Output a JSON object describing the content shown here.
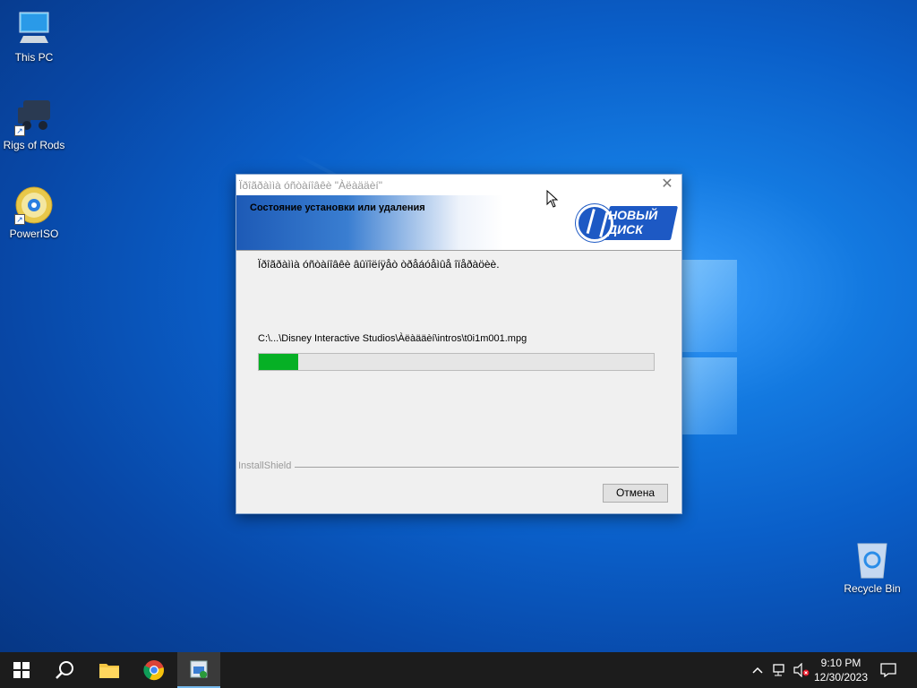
{
  "desktop": {
    "icons": [
      {
        "label": "This PC"
      },
      {
        "label": "Rigs of Rods"
      },
      {
        "label": "PowerISO"
      },
      {
        "label": "Recycle Bin"
      }
    ]
  },
  "dialog": {
    "title": "Ïðîãðàììà óñòàíîâêè \"Àëàääèí\"",
    "heading": "Состояние установки или удаления",
    "brand_logo_text": "НОВЫЙ ДИСК",
    "status_message": "Ïðîãðàììà óñòàíîâêè âûïîëíÿåò òðåáóåìûå îïåðàöèè.",
    "file_path": "C:\\...\\Disney Interactive Studios\\Àëàääèí\\intros\\t0i1m001.mpg",
    "progress_fraction": 0.1,
    "progress_color": "#06b025",
    "footer_brand": "InstallShield",
    "cancel_label": "Отмена"
  },
  "taskbar": {
    "clock_time": "9:10 PM",
    "clock_date": "12/30/2023",
    "icons": [
      "start-icon",
      "search-icon",
      "file-explorer-icon",
      "chrome-icon",
      "installer-icon"
    ],
    "tray_icons": [
      "chevron-up-icon",
      "network-icon",
      "volume-muted-icon",
      "notification-icon"
    ]
  }
}
